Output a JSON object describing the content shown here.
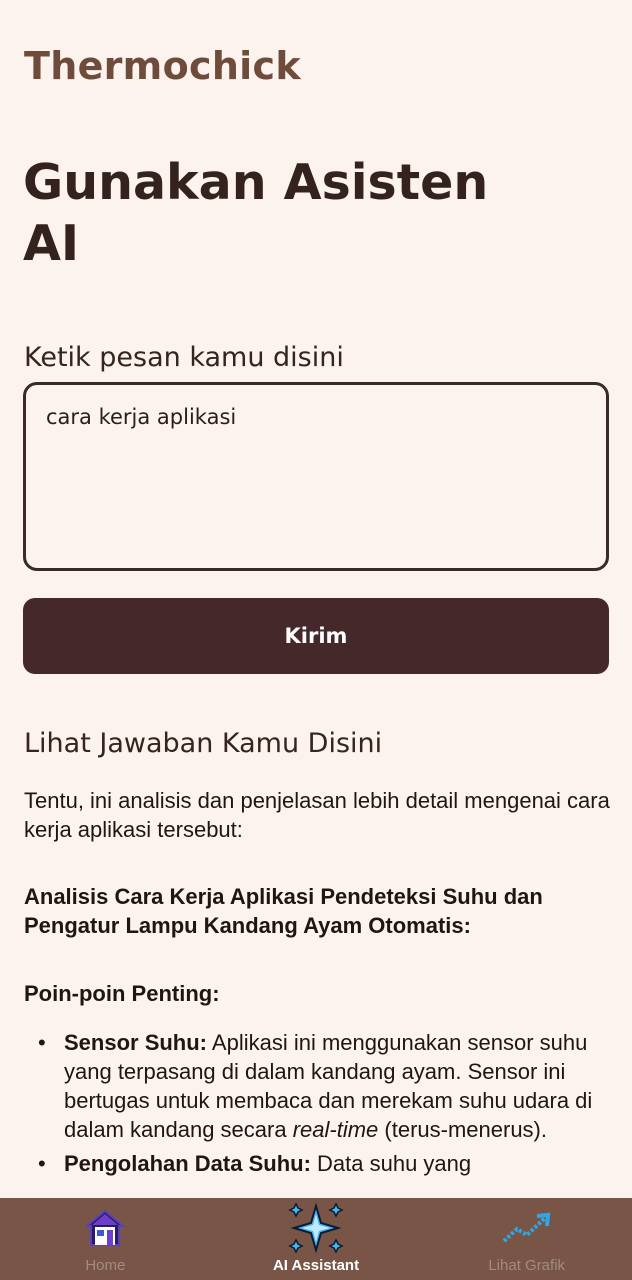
{
  "app": {
    "title": "Thermochick"
  },
  "page": {
    "title": "Gunakan Asisten AI"
  },
  "form": {
    "label": "Ketik pesan kamu disini",
    "message_value": "cara kerja aplikasi",
    "send_label": "Kirim"
  },
  "answer": {
    "title": "Lihat Jawaban Kamu Disini",
    "intro": "Tentu, ini analisis dan penjelasan lebih detail mengenai cara kerja aplikasi tersebut:",
    "heading": "Analisis Cara Kerja Aplikasi Pendeteksi Suhu dan Pengatur Lampu Kandang Ayam Otomatis:",
    "subheading": "Poin-poin Penting:",
    "items": [
      {
        "term": "Sensor Suhu:",
        "text_before": " Aplikasi ini menggunakan sensor suhu yang terpasang di dalam kandang ayam. Sensor ini bertugas untuk membaca dan merekam suhu udara di dalam kandang secara ",
        "emphasis": "real-time",
        "text_after": " (terus-menerus)."
      },
      {
        "term": "Pengolahan Data Suhu:",
        "text": " Data suhu yang"
      }
    ]
  },
  "nav": {
    "items": [
      {
        "label": "Home",
        "icon": "home-icon"
      },
      {
        "label": "AI Assistant",
        "icon": "sparkle-icon",
        "active": true
      },
      {
        "label": "Lihat Grafik",
        "icon": "chart-trend-icon"
      }
    ]
  },
  "colors": {
    "background": "#fcf2ee",
    "brand": "#6e4b3b",
    "button": "#45292a",
    "nav_bar": "#795548"
  }
}
